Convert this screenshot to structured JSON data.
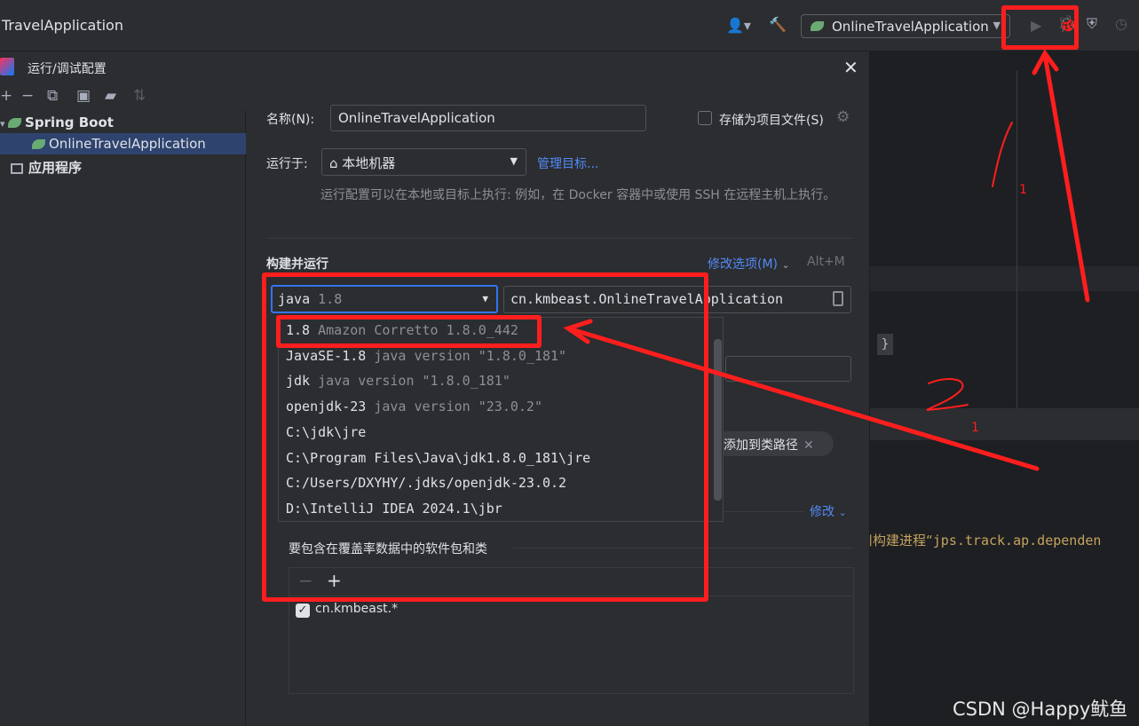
{
  "ide": {
    "title": "TravelApplication",
    "run_config": "OnlineTravelApplication"
  },
  "dialog": {
    "title": "运行/调试配置",
    "close": "✕"
  },
  "tree": {
    "group": "Spring Boot",
    "selected_item": "OnlineTravelApplication",
    "app_group": "应用程序"
  },
  "form": {
    "name_label": "名称(N):",
    "name_value": "OnlineTravelApplication",
    "store_label": "存储为项目文件(S)",
    "run_on_label": "运行于:",
    "run_on_value": "本地机器",
    "manage_targets": "管理目标...",
    "hint": "运行配置可以在本地或目标上执行: 例如，在 Docker 容器中或使用 SSH 在远程主机上执行。",
    "section_title": "构建并运行",
    "modify_options": "修改选项(M)",
    "modify_shortcut": "Alt+M",
    "jdk_name": "java",
    "jdk_version": "1.8",
    "main_class": "cn.kmbeast.OnlineTravelApplication",
    "chip_label": "添加到类路径",
    "modify_link": "修改"
  },
  "jdk_options": [
    {
      "name": "1.8",
      "detail": "Amazon Corretto 1.8.0_442"
    },
    {
      "name": "JavaSE-1.8",
      "detail": "java version \"1.8.0_181\""
    },
    {
      "name": "jdk",
      "detail": "java version \"1.8.0_181\""
    },
    {
      "name": "openjdk-23",
      "detail": "java version \"23.0.2\""
    },
    {
      "name": "C:\\jdk\\jre",
      "detail": ""
    },
    {
      "name": "C:\\Program Files\\Java\\jdk1.8.0_181\\jre",
      "detail": ""
    },
    {
      "name": "C:/Users/DXYHY/.jdks/openjdk-23.0.2",
      "detail": ""
    },
    {
      "name": "D:\\IntelliJ IDEA 2024.1\\jbr",
      "detail": ""
    }
  ],
  "coverage": {
    "label": "要包含在覆盖率数据中的软件包和类",
    "item": "cn.kmbeast.*"
  },
  "editor": {
    "brace": "}",
    "message_cn": "用构建进程“",
    "message_code": "jps.track.ap.dependen"
  },
  "annotations": {
    "num1": "1",
    "num2": "2"
  },
  "watermark": "CSDN @Happy鱿鱼",
  "colors": {
    "accent": "#3574f0",
    "annotation": "#ff1e1e",
    "link": "#548af7"
  }
}
